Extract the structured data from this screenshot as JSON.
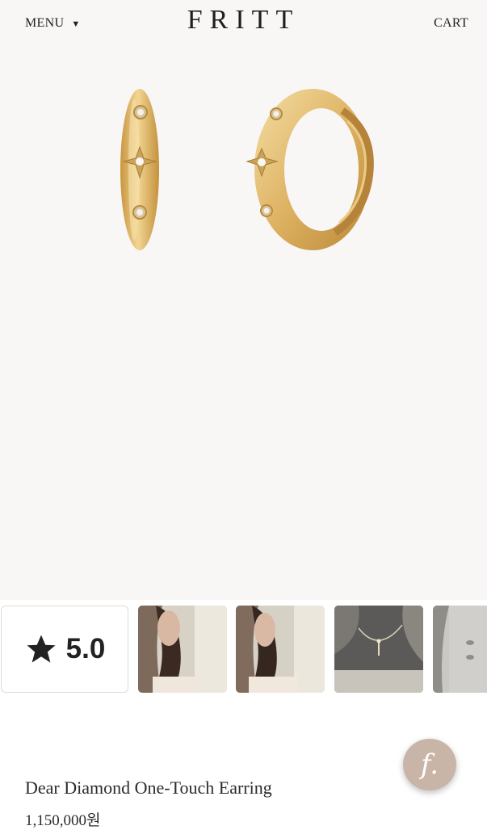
{
  "header": {
    "menu_label": "MENU",
    "menu_caret": "▼",
    "logo": "FRITT",
    "cart_label": "CART"
  },
  "hero": {
    "image_subject": "gold hoop earrings with star-set diamonds"
  },
  "gallery": {
    "rating": "5.0",
    "rating_icon": "star-icon",
    "thumbnails": [
      "earring-worn-photo-1",
      "earring-worn-photo-2",
      "necklace-photo",
      "earring-detail-photo"
    ]
  },
  "product": {
    "title": "Dear Diamond One-Touch Earring",
    "price": "1,150,000원"
  },
  "fab": {
    "icon": "f."
  },
  "colors": {
    "hero_bg": "#f9f7f6",
    "gold": "#e1b96e",
    "fab_bg": "#c9b4a8"
  }
}
